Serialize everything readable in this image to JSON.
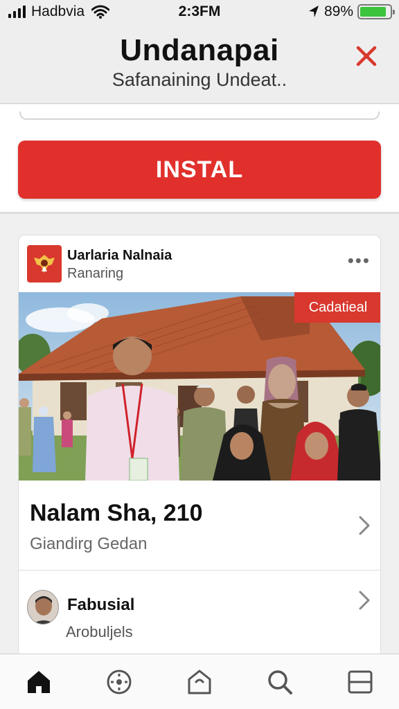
{
  "status_bar": {
    "carrier": "Hadbvia",
    "time": "2:3FM",
    "battery_percent": "89%",
    "battery_level": 0.89
  },
  "header": {
    "title": "Undanapai",
    "subtitle": "Safanaining Undeat.."
  },
  "install": {
    "label": "INSTAL"
  },
  "card": {
    "page_name": "Uarlaria Nalnaia",
    "page_subtitle": "Ranaring",
    "photo_badge": "Cadatieal",
    "main_title": "Nalam Sha, 210",
    "main_subtitle": "Giandirg Gedan",
    "user_name": "Fabusial",
    "user_subtitle": "Arobuljels"
  },
  "bottom_nav": [
    "home-icon",
    "compass-icon",
    "tag-home-icon",
    "search-icon",
    "layout-icon"
  ],
  "colors": {
    "accent": "#e1302c",
    "battery": "#3cc43c",
    "close": "#d8382e"
  }
}
